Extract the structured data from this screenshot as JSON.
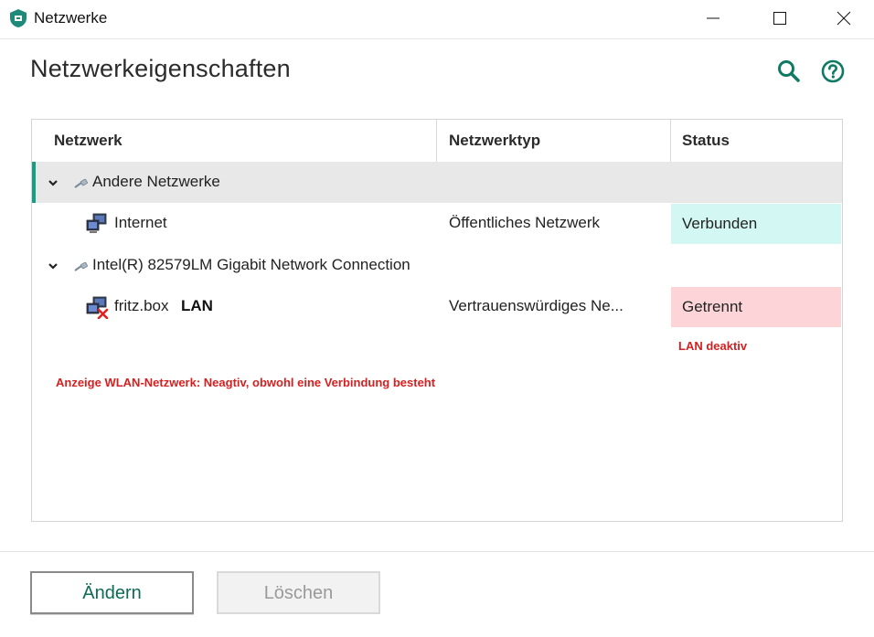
{
  "window": {
    "title": "Netzwerke",
    "controls": [
      "minimize-icon",
      "maximize-icon",
      "close-icon"
    ]
  },
  "header": {
    "title": "Netzwerkeigenschaften",
    "icons": [
      "search-icon",
      "help-icon"
    ]
  },
  "table": {
    "columns": [
      "Netzwerk",
      "Netzwerktyp",
      "Status"
    ],
    "groups": [
      {
        "label": "Andere Netzwerke",
        "selected": true,
        "networks": [
          {
            "name": "Internet",
            "type": "Öffentliches Netzwerk",
            "status": "Verbunden",
            "tag": ""
          }
        ]
      },
      {
        "label": "Intel(R) 82579LM Gigabit Network Connection",
        "selected": false,
        "networks": [
          {
            "name": "fritz.box",
            "type": "Vertrauenswürdiges Ne...",
            "status": "Getrennt",
            "tag": "LAN"
          }
        ]
      }
    ]
  },
  "annotations": {
    "lan_status_note": "LAN deaktiv",
    "wlan_note": "Anzeige WLAN-Netzwerk: Neagtiv, obwohl eine Verbindung besteht"
  },
  "footer": {
    "change_label": "Ändern",
    "delete_label": "Löschen"
  },
  "colors": {
    "accent": "#15a086",
    "connected_bg": "#d3f8f3",
    "disconnected_bg": "#fdd5d8",
    "annotation_red": "#d42020",
    "button_text_green": "#0d6b56"
  }
}
